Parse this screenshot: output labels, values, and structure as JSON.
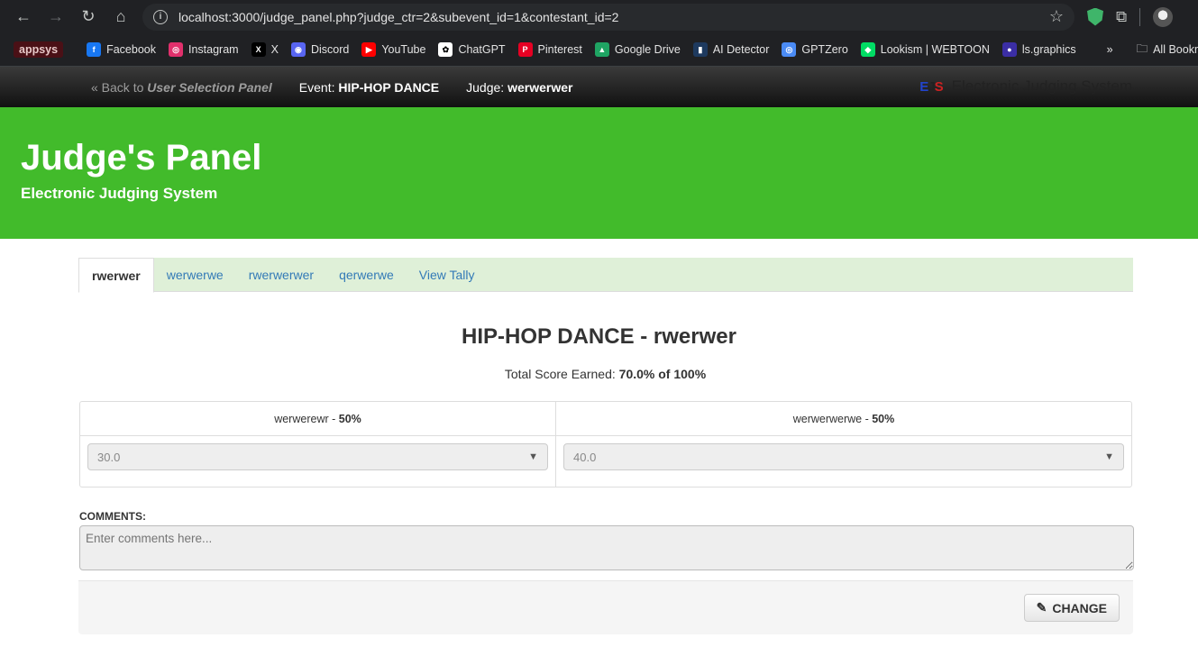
{
  "browser": {
    "url": "localhost:3000/judge_panel.php?judge_ctr=2&subevent_id=1&contestant_id=2",
    "bookmarks": [
      {
        "label": "appsys"
      },
      {
        "label": "Facebook",
        "color": "#1877f2",
        "glyph": "f"
      },
      {
        "label": "Instagram",
        "color": "#e1306c",
        "glyph": "◎"
      },
      {
        "label": "X",
        "color": "#000000",
        "glyph": "X"
      },
      {
        "label": "Discord",
        "color": "#5865f2",
        "glyph": "◉"
      },
      {
        "label": "YouTube",
        "color": "#ff0000",
        "glyph": "▶"
      },
      {
        "label": "ChatGPT",
        "color": "#ffffff",
        "glyph": "✿"
      },
      {
        "label": "Pinterest",
        "color": "#e60023",
        "glyph": "P"
      },
      {
        "label": "Google Drive",
        "color": "#1fa463",
        "glyph": "▲"
      },
      {
        "label": "AI Detector",
        "color": "#1e3a5f",
        "glyph": "▮"
      },
      {
        "label": "GPTZero",
        "color": "#4a8bf5",
        "glyph": "◎"
      },
      {
        "label": "Lookism | WEBTOON",
        "color": "#00dc64",
        "glyph": "◆"
      },
      {
        "label": "ls.graphics",
        "color": "#3b2ea5",
        "glyph": "●"
      }
    ],
    "all_bookmarks": "All Bookma"
  },
  "nav": {
    "back_prefix": "« Back to ",
    "back_link": "User Selection Panel",
    "event_prefix": "Event: ",
    "event_name": "HIP-HOP DANCE",
    "judge_prefix": "Judge: ",
    "judge_name": "werwerwer",
    "brand_logo": "EJS",
    "brand_text": "Electronic Judging System"
  },
  "jumbotron": {
    "title": "Judge's Panel",
    "subtitle": "Electronic Judging System"
  },
  "tabs": [
    "rwerwer",
    "werwerwe",
    "rwerwerwer",
    "qerwerwe",
    "View Tally"
  ],
  "main": {
    "heading": "HIP-HOP DANCE - rwerwer",
    "score_prefix": "Total Score Earned: ",
    "score_value": "70.0% of 100%",
    "criteria": [
      {
        "name": "werwerewr",
        "weight": "50%",
        "value": "30.0"
      },
      {
        "name": "werwerwerwe",
        "weight": "50%",
        "value": "40.0"
      }
    ],
    "comments_label": "COMMENTS:",
    "comments_placeholder": "Enter comments here...",
    "change_label": "CHANGE"
  },
  "colors": {
    "jumbotron_bg": "#42bb2b",
    "tabs_bg": "#dff0d8",
    "link": "#337ab7"
  }
}
